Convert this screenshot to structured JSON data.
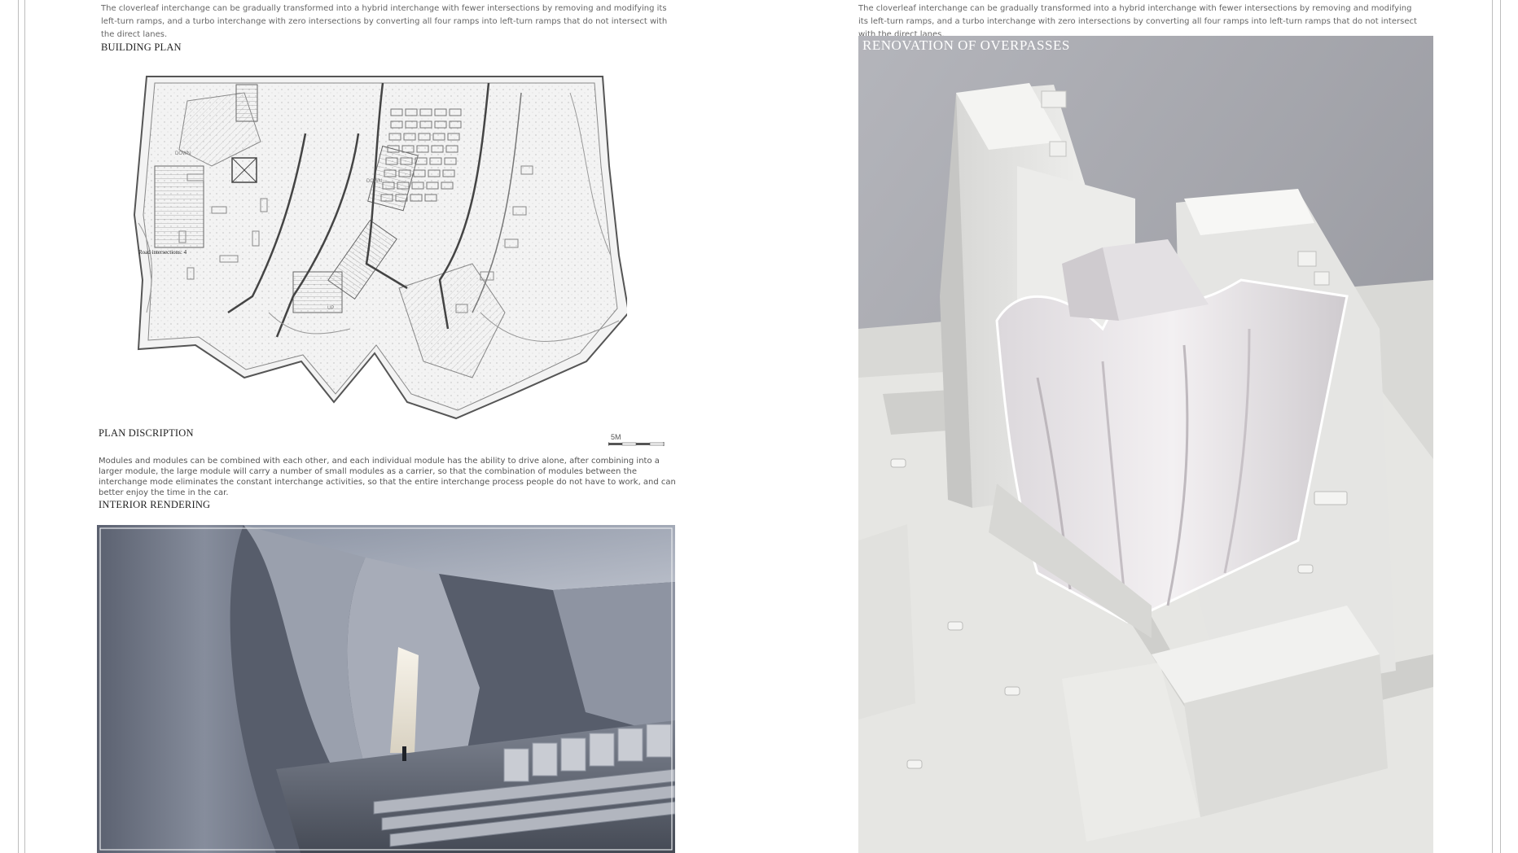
{
  "left_column": {
    "intro_text": "The cloverleaf interchange can be gradually transformed into a hybrid interchange with fewer intersections by removing and modifying its left-turn ramps, and a turbo interchange with zero intersections by converting all four ramps into left-turn ramps that do not intersect with the direct lanes.",
    "building_plan_heading": "BUILDING PLAN",
    "plan_labels": {
      "down_1": "DOWN",
      "down_2": "DOWN",
      "up": "UP",
      "road_intersections": "Road intersections: 4"
    },
    "plan_description_heading": "PLAN DISCRIPTION",
    "scale_label": "5M",
    "plan_description_text": "Modules and modules can be combined with each other, and each individual module has the ability to drive alone, after combining into a larger module, the large module will carry a number of small modules as a carrier, so that the combination of modules between the interchange mode eliminates the constant interchange activities, so that the entire interchange process people do not have to work, and can better enjoy the time in the car.",
    "interior_rendering_heading": "INTERIOR RENDERING"
  },
  "right_column": {
    "intro_text": "The cloverleaf interchange can be gradually transformed into a hybrid interchange with fewer intersections by removing and modifying its left-turn ramps, and a turbo interchange with zero intersections by converting all four ramps into left-turn ramps that do not intersect with the direct lanes.",
    "photo_title": "RENOVATION OF OVERPASSES"
  },
  "colors": {
    "background": "#ffffff",
    "heading": "#222222",
    "body_text": "#666666",
    "frame_line": "#bdbdbd",
    "photo_title": "#ffffff"
  }
}
